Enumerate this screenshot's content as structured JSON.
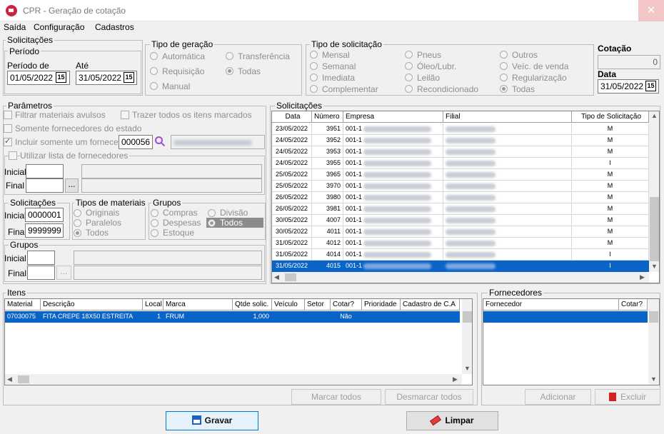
{
  "window": {
    "title": "CPR - Geração de cotação",
    "close": "✕"
  },
  "menu": [
    "Saída",
    "Configuração",
    "Cadastros"
  ],
  "solic": {
    "legend": "Solicitações",
    "periodo": "Período",
    "de_label": "Período de",
    "ate_label": "Até",
    "de": "01/05/2022",
    "ate": "31/05/2022",
    "cal": "15"
  },
  "tipo_geracao": {
    "legend": "Tipo de geração",
    "opts": [
      "Automática",
      "Transferência",
      "Requisição",
      "Todas",
      "Manual"
    ]
  },
  "tipo_solic": {
    "legend": "Tipo de solicitação",
    "opts": [
      "Mensal",
      "Pneus",
      "Outros",
      "Semanal",
      "Óleo/Lubr.",
      "Veíc. de venda",
      "Imediata",
      "Leilão",
      "Regularização",
      "Complementar",
      "Recondicionado",
      "Todas"
    ]
  },
  "cotacao": {
    "label": "Cotação",
    "value": "0",
    "data_label": "Data",
    "data": "31/05/2022"
  },
  "param": {
    "legend": "Parâmetros",
    "filtrar": "Filtrar materiais avulsos",
    "trazer": "Trazer todos os itens marcados",
    "somente": "Somente fornecedores do estado",
    "incluir": "Incluir somente um fornecedor",
    "fornecedor": "000056",
    "utilizar": "Utilizar lista de fornecedores",
    "inicial": "Inicial",
    "final": "Final",
    "ellipsis": "..."
  },
  "solic_range": {
    "legend": "Solicitações",
    "inicial": "Inicial",
    "final": "Final",
    "ini": "0000001",
    "fin": "9999999"
  },
  "tipos_mat": {
    "legend": "Tipos de materiais",
    "opts": [
      "Originais",
      "Paralelos",
      "Todos"
    ]
  },
  "grupos_radio": {
    "legend": "Grupos",
    "opts": [
      "Compras",
      "Divisão",
      "Despesas",
      "Todos",
      "Estoque"
    ]
  },
  "grupos": {
    "legend": "Grupos",
    "inicial": "Inicial",
    "final": "Final",
    "ellipsis": "..."
  },
  "solicitacoes": {
    "legend": "Solicitações",
    "headers": [
      "Data",
      "Número",
      "Empresa",
      "Filial",
      "Tipo de Solicitação"
    ],
    "rows": [
      {
        "data": "23/05/2022",
        "numero": "3951",
        "empresa": "001-1",
        "tipo": "M"
      },
      {
        "data": "24/05/2022",
        "numero": "3952",
        "empresa": "001-1",
        "tipo": "M"
      },
      {
        "data": "24/05/2022",
        "numero": "3953",
        "empresa": "001-1",
        "tipo": "M"
      },
      {
        "data": "24/05/2022",
        "numero": "3955",
        "empresa": "001-1",
        "tipo": "I"
      },
      {
        "data": "25/05/2022",
        "numero": "3965",
        "empresa": "001-1",
        "tipo": "M"
      },
      {
        "data": "25/05/2022",
        "numero": "3970",
        "empresa": "001-1",
        "tipo": "M"
      },
      {
        "data": "26/05/2022",
        "numero": "3980",
        "empresa": "001-1",
        "tipo": "M"
      },
      {
        "data": "26/05/2022",
        "numero": "3981",
        "empresa": "001-1",
        "tipo": "M"
      },
      {
        "data": "30/05/2022",
        "numero": "4007",
        "empresa": "001-1",
        "tipo": "M"
      },
      {
        "data": "30/05/2022",
        "numero": "4011",
        "empresa": "001-1",
        "tipo": "M"
      },
      {
        "data": "31/05/2022",
        "numero": "4012",
        "empresa": "001-1",
        "tipo": "M"
      },
      {
        "data": "31/05/2022",
        "numero": "4014",
        "empresa": "001-1",
        "tipo": "I"
      },
      {
        "data": "31/05/2022",
        "numero": "4015",
        "empresa": "001-1",
        "tipo": "I"
      }
    ]
  },
  "itens": {
    "legend": "Itens",
    "headers": [
      "Material",
      "Descrição",
      "Local",
      "Marca",
      "Qtde solic.",
      "Veículo",
      "Setor",
      "Cotar?",
      "Prioridade",
      "Cadastro de C.A"
    ],
    "rows": [
      {
        "material": "07030075",
        "descricao": "FITA CREPE 18X50 ESTREITA",
        "local": "1",
        "marca": "FRUM",
        "qtde": "1,000",
        "veiculo": "",
        "setor": "",
        "cotar": "Não",
        "prioridade": "",
        "cadastro": ""
      }
    ],
    "marcar": "Marcar todos",
    "desmarcar": "Desmarcar todos"
  },
  "fornecedores": {
    "legend": "Fornecedores",
    "headers": [
      "Fornecedor",
      "Cotar?"
    ],
    "adicionar": "Adicionar",
    "excluir": "Excluir"
  },
  "footer": {
    "gravar": "Gravar",
    "limpar": "Limpar"
  }
}
